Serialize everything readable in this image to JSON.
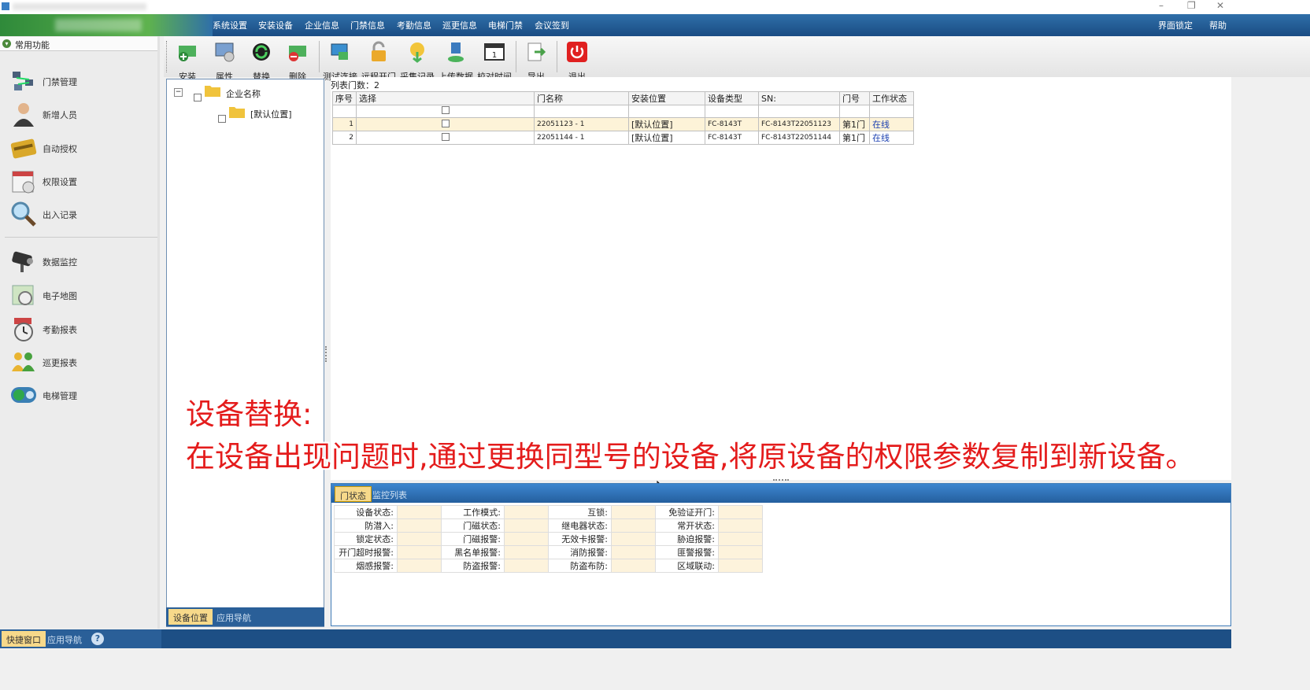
{
  "window": {
    "minimize_glyph": "–",
    "restore_glyph": "❐",
    "close_glyph": "✕"
  },
  "menu": {
    "items": [
      "系统设置",
      "安装设备",
      "企业信息",
      "门禁信息",
      "考勤信息",
      "巡更信息",
      "电梯门禁",
      "会议签到"
    ],
    "lock_label": "界面锁定",
    "help_label": "帮助"
  },
  "sidebar": {
    "header": "常用功能",
    "items": [
      {
        "label": "门禁管理",
        "icon": "network-icon"
      },
      {
        "label": "新增人员",
        "icon": "person-icon"
      },
      {
        "label": "自动授权",
        "icon": "card-icon"
      },
      {
        "label": "权限设置",
        "icon": "calendar-icon"
      },
      {
        "label": "出入记录",
        "icon": "magnifier-icon"
      },
      {
        "label": "数据监控",
        "icon": "camera-icon"
      },
      {
        "label": "电子地图",
        "icon": "map-icon"
      },
      {
        "label": "考勤报表",
        "icon": "clock-icon"
      },
      {
        "label": "巡更报表",
        "icon": "people-icon"
      },
      {
        "label": "电梯管理",
        "icon": "elevator-icon"
      }
    ]
  },
  "toolbar": {
    "items": [
      {
        "label": "安装",
        "icon": "install-icon",
        "color": "#3fa34d"
      },
      {
        "label": "属性",
        "icon": "properties-icon",
        "color": "#5b7fb5"
      },
      {
        "label": "替换",
        "icon": "replace-icon",
        "color": "#2c8c3c"
      },
      {
        "label": "删除",
        "icon": "delete-icon",
        "color": "#c94141"
      },
      {
        "label": "测试连接",
        "icon": "test-connection-icon",
        "color": "#3a8fd0"
      },
      {
        "label": "远程开门",
        "icon": "unlock-icon",
        "color": "#e0a323"
      },
      {
        "label": "采集记录",
        "icon": "collect-icon",
        "color": "#6bb23a"
      },
      {
        "label": "上传数据",
        "icon": "upload-icon",
        "color": "#3b7bbf"
      },
      {
        "label": "校对时间",
        "icon": "calendar-icon",
        "color": "#555555"
      },
      {
        "label": "导出",
        "icon": "export-icon",
        "color": "#4aa24a"
      },
      {
        "label": "退出",
        "icon": "power-icon",
        "color": "#e02020"
      }
    ]
  },
  "tree": {
    "root": "企业名称",
    "child": "[默认位置]",
    "tabs": [
      "设备位置",
      "应用导航"
    ]
  },
  "grid": {
    "count_label": "列表门数：2",
    "columns": [
      "序号",
      "选择",
      "门名称",
      "安装位置",
      "设备类型",
      "SN:",
      "门号",
      "工作状态"
    ],
    "rows": [
      [
        "1",
        "",
        "22051123 - 1",
        "[默认位置]",
        "FC-8143T",
        "FC-8143T22051123",
        "第1门",
        "在线"
      ],
      [
        "2",
        "",
        "22051144 - 1",
        "[默认位置]",
        "FC-8143T",
        "FC-8143T22051144",
        "第1门",
        "在线"
      ]
    ]
  },
  "bottom": {
    "tabs": [
      "门状态",
      "监控列表"
    ],
    "fields": [
      [
        "设备状态:",
        "工作模式:",
        "互锁:",
        "免验证开门:"
      ],
      [
        "防潜入:",
        "门磁状态:",
        "继电器状态:",
        "常开状态:"
      ],
      [
        "锁定状态:",
        "门磁报警:",
        "无效卡报警:",
        "胁迫报警:"
      ],
      [
        "开门超时报警:",
        "黑名单报警:",
        "消防报警:",
        "匪警报警:"
      ],
      [
        "烟感报警:",
        "防盗报警:",
        "防盗布防:",
        "区域联动:"
      ]
    ]
  },
  "statusbar": {
    "tabs": [
      "快捷窗口",
      "应用导航"
    ],
    "help_glyph": "?"
  },
  "caption": {
    "line1": "设备替换:",
    "line2": "在设备出现问题时,通过更换同型号的设备,将原设备的权限参数复制到新设备。"
  }
}
